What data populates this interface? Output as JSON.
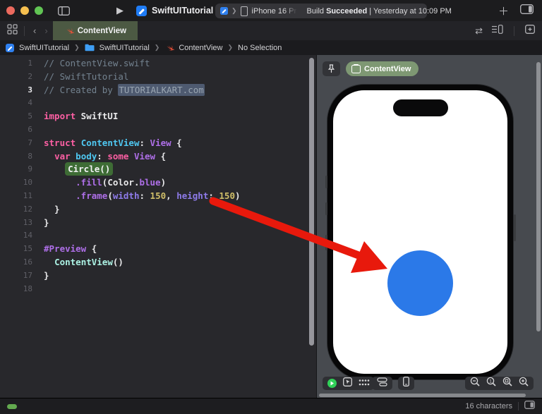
{
  "theme": {
    "circle-blue": "#2b79e8",
    "arrow-red": "#e8190c",
    "tab-green": "#4c5943",
    "pill-green": "#7e9873",
    "c-kw": "#fc5fa3",
    "c-decl": "#4fc8f2",
    "c-type": "#ae6fe8",
    "c-param": "#8e7bea",
    "c-num": "#d0bf69",
    "c-mint": "#acf2e4",
    "c-comment": "#73828f",
    "c-hlbg": "#3e6c35",
    "c-selbg": "#4e5a70"
  },
  "titlebar": {
    "project_title": "SwiftUITutorial",
    "device_name": "iPhone 16 Pr",
    "build_prefix": "Build ",
    "build_bold": "Succeeded",
    "build_suffix": " | Yesterday at 10:09 PM"
  },
  "tabbar": {
    "active_tab": "ContentView"
  },
  "jumpbar": {
    "items": [
      "SwiftUITutorial",
      "SwiftUITutorial",
      "ContentView",
      "No Selection"
    ]
  },
  "editor": {
    "lines": [
      {
        "n": "1",
        "tokens": [
          [
            "comment",
            "// ContentView.swift"
          ]
        ]
      },
      {
        "n": "2",
        "tokens": [
          [
            "comment",
            "// SwiftTutorial"
          ]
        ]
      },
      {
        "n": "3",
        "active": true,
        "tokens": [
          [
            "comment",
            "// Created by "
          ],
          [
            "comment-sel",
            "TUTORIALKART.com"
          ]
        ]
      },
      {
        "n": "4",
        "tokens": []
      },
      {
        "n": "5",
        "tokens": [
          [
            "kw",
            "import"
          ],
          [
            "plain",
            " SwiftUI"
          ]
        ]
      },
      {
        "n": "6",
        "tokens": []
      },
      {
        "n": "7",
        "tokens": [
          [
            "kw",
            "struct"
          ],
          [
            "plain",
            " "
          ],
          [
            "decl",
            "ContentView"
          ],
          [
            "plain",
            ": "
          ],
          [
            "type",
            "View"
          ],
          [
            "plain",
            " {"
          ]
        ]
      },
      {
        "n": "8",
        "tokens": [
          [
            "plain",
            "  "
          ],
          [
            "kw",
            "var"
          ],
          [
            "plain",
            " "
          ],
          [
            "decl",
            "body"
          ],
          [
            "plain",
            ": "
          ],
          [
            "kw",
            "some"
          ],
          [
            "plain",
            " "
          ],
          [
            "type",
            "View"
          ],
          [
            "plain",
            " {"
          ]
        ]
      },
      {
        "n": "9",
        "tokens": [
          [
            "plain",
            "    "
          ],
          [
            "hl",
            "Circle()"
          ]
        ]
      },
      {
        "n": "10",
        "tokens": [
          [
            "plain",
            "      "
          ],
          [
            "type",
            ".fill"
          ],
          [
            "plain",
            "("
          ],
          [
            "plain",
            "Color."
          ],
          [
            "type",
            "blue"
          ],
          [
            "plain",
            ")"
          ]
        ]
      },
      {
        "n": "11",
        "tokens": [
          [
            "plain",
            "      "
          ],
          [
            "type",
            ".frame"
          ],
          [
            "plain",
            "("
          ],
          [
            "param",
            "width"
          ],
          [
            "plain",
            ": "
          ],
          [
            "num",
            "150"
          ],
          [
            "plain",
            ", "
          ],
          [
            "param",
            "height"
          ],
          [
            "plain",
            ": "
          ],
          [
            "num",
            "150"
          ],
          [
            "plain",
            ")"
          ]
        ]
      },
      {
        "n": "12",
        "tokens": [
          [
            "plain",
            "  }"
          ]
        ]
      },
      {
        "n": "13",
        "tokens": [
          [
            "plain",
            "}"
          ]
        ]
      },
      {
        "n": "14",
        "tokens": []
      },
      {
        "n": "15",
        "tokens": [
          [
            "type",
            "#Preview"
          ],
          [
            "plain",
            " {"
          ]
        ]
      },
      {
        "n": "16",
        "tokens": [
          [
            "plain",
            "  "
          ],
          [
            "mint",
            "ContentView"
          ],
          [
            "plain",
            "()"
          ]
        ]
      },
      {
        "n": "17",
        "tokens": [
          [
            "plain",
            "}"
          ]
        ]
      },
      {
        "n": "18",
        "tokens": []
      }
    ]
  },
  "preview": {
    "pill_label": "ContentView"
  },
  "statusbar": {
    "char_count": "16 characters"
  }
}
